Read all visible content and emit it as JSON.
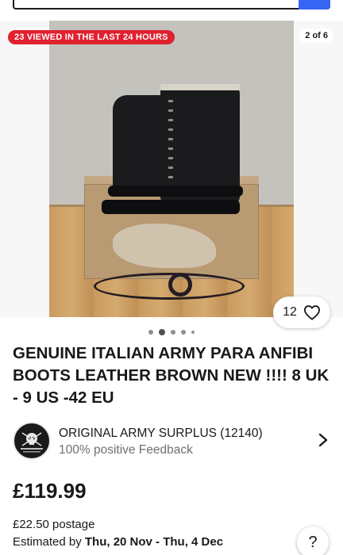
{
  "gallery": {
    "views_badge": "23 VIEWED IN THE LAST 24 HOURS",
    "image_counter": "2 of 6",
    "watch_count": "12",
    "pagination_total": 5,
    "pagination_active": 2
  },
  "listing": {
    "title": "GENUINE ITALIAN ARMY PARA ANFIBI BOOTS LEATHER BROWN NEW !!!! 8 UK - 9 US -42 EU",
    "price": "£119.99",
    "postage": "£22.50 postage",
    "delivery_prefix": "Estimated by",
    "delivery_dates": "Thu, 20 Nov - Thu, 4 Dec"
  },
  "seller": {
    "name": "ORIGINAL ARMY SURPLUS (12140)",
    "feedback": "100% positive Feedback"
  },
  "help": {
    "label": "?"
  },
  "colors": {
    "badge_red": "#e0212f",
    "accent_blue": "#3665f3",
    "text": "#191919",
    "muted": "#707070"
  },
  "icons": [
    "heart-icon",
    "chevron-right-icon",
    "help-icon"
  ]
}
